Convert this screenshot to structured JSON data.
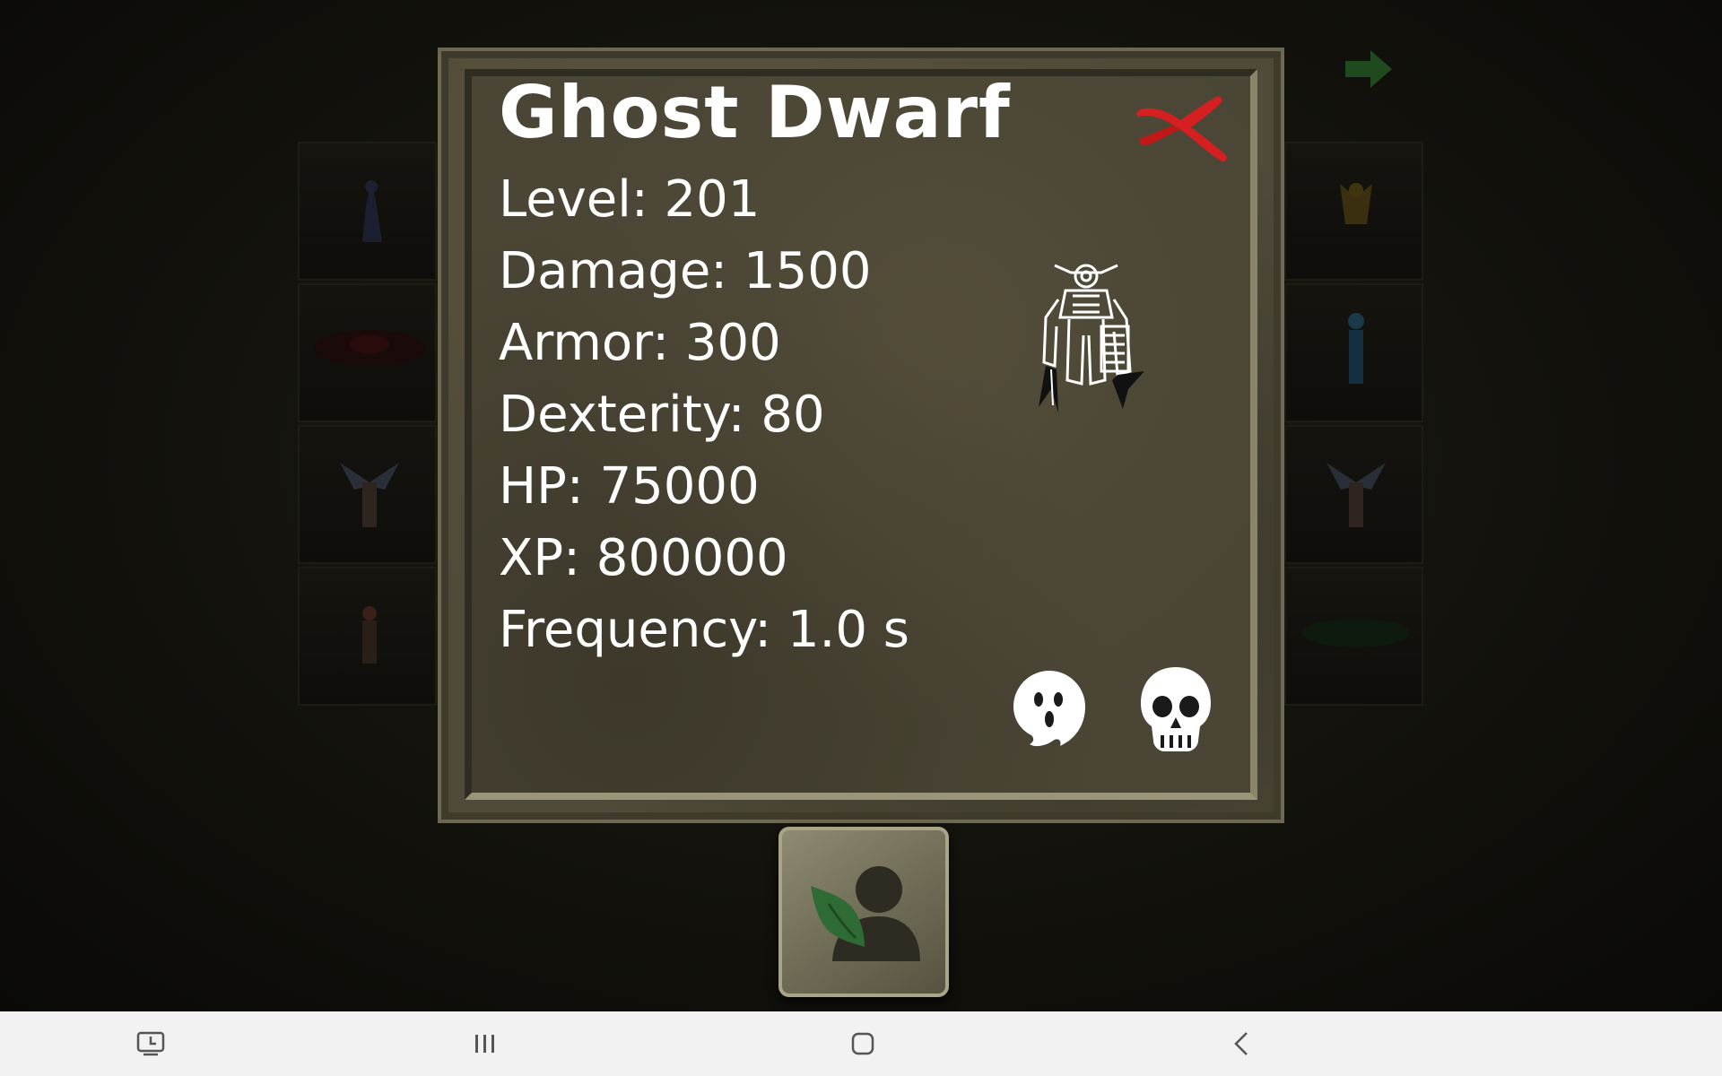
{
  "monster": {
    "name": "Ghost Dwarf",
    "stats": {
      "level": "Level: 201",
      "damage": "Damage: 1500",
      "armor": "Armor: 300",
      "dexterity": "Dexterity: 80",
      "hp": "HP: 75000",
      "xp": "XP: 800000",
      "frequency": "Frequency: 1.0 s"
    },
    "traits": [
      "ghost-icon",
      "skull-icon"
    ]
  },
  "icons": {
    "close": "close-x-icon",
    "next": "next-arrow-icon",
    "profile": "character-profile-icon"
  },
  "colors": {
    "panel": "#4a4535",
    "close_x": "#d42020",
    "next_arrow": "#1e4a1e",
    "text": "#ffffff"
  },
  "nav_bar": {
    "buttons": [
      "screenshot-icon",
      "recent-apps-icon",
      "home-icon",
      "back-icon"
    ]
  }
}
